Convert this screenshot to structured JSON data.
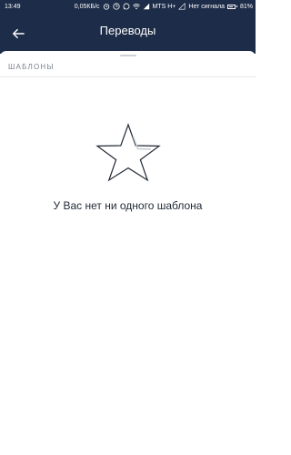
{
  "status_bar": {
    "time": "13:49",
    "network_speed": "0,05КБ/с",
    "carrier_1": "MTS H+",
    "carrier_2": "Нет сигнала",
    "battery_percent": "81%",
    "battery_level": 0.81,
    "icons": [
      "alarm-icon",
      "clock-icon",
      "whatsapp-icon",
      "wifi-icon",
      "signal-icon"
    ]
  },
  "app_bar": {
    "title": "Переводы",
    "back_icon": "arrow-left-icon"
  },
  "templates": {
    "section_header": "ШАБЛОНЫ",
    "empty_icon": "star-outline-icon",
    "empty_message": "У Вас нет ни одного шаблона"
  },
  "colors": {
    "header_bg": "#1d2c48",
    "text_primary": "#222a36",
    "text_secondary": "#7b818c"
  }
}
